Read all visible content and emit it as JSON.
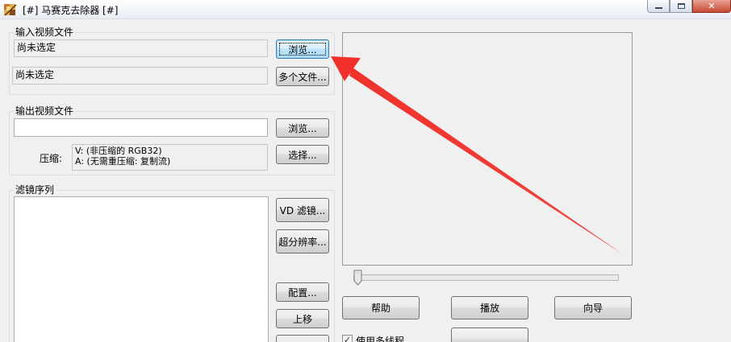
{
  "window": {
    "title": "[#] 马赛克去除器 [#]",
    "controls": {
      "minimize": "minimize",
      "maximize": "maximize",
      "close": "✕"
    }
  },
  "input_group": {
    "label": "输入视频文件",
    "file_status": "尚未选定",
    "batch_status": "尚未选定",
    "browse_button": "浏览...",
    "multi_file_button": "多个文件..."
  },
  "output_group": {
    "label": "输出视频文件",
    "output_path": "",
    "browse_button": "浏览...",
    "compression_label": "压缩:",
    "compression_video": "V: (非压缩的 RGB32)",
    "compression_audio": "A: (无需重压缩: 复制流)",
    "select_button": "选择..."
  },
  "filter_group": {
    "label": "滤镜序列",
    "vd_filter_button": "VD 滤镜...",
    "super_resolution_button": "超分辨率...",
    "configure_button": "配置...",
    "move_up_button": "上移"
  },
  "actions": {
    "help_button": "帮助",
    "play_button": "播放",
    "wizard_button": "向导",
    "multithread_label": "使用多线程"
  },
  "slider": {
    "position": 0
  },
  "colors": {
    "annotation_arrow": "#f0302a",
    "focus_border": "#3c7fb1",
    "window_bg": "#f0f0f0"
  },
  "icons": {
    "app": "mosaic-app-icon",
    "check": "checkbox-check-icon"
  }
}
